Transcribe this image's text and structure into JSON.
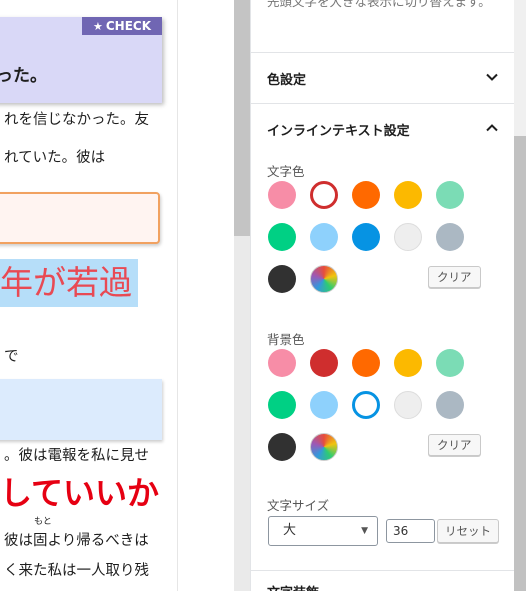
{
  "editor": {
    "check_label": "CHECK",
    "check_text": "った。",
    "paragraphs": [
      "れを信じなかった。友",
      "れていた。彼は",
      "で",
      "。彼は電報を私に見せ",
      "彼は固より帰るべきは",
      "く来た私は一人取り残"
    ],
    "highlight_text": "年が若過",
    "bold_red_text": "していいか",
    "ruby_text": "もと"
  },
  "sidebar": {
    "help_text": "先頭文字を大きな表示に切り替えます。",
    "color_panel": {
      "title": "色設定"
    },
    "inline_panel": {
      "title": "インラインテキスト設定",
      "text_color_label": "文字色",
      "text_colors": [
        "#f78da7",
        "#cf2e2e",
        "#ff6900",
        "#fcb900",
        "#7bdcb5",
        "#00d084",
        "#8ed1fc",
        "#0693e3",
        "#eeeeee",
        "#abb8c3",
        "#313131",
        "gradient"
      ],
      "text_color_selected": "#cf2e2e",
      "bg_color_label": "背景色",
      "bg_colors": [
        "#f78da7",
        "#cf2e2e",
        "#ff6900",
        "#fcb900",
        "#7bdcb5",
        "#00d084",
        "#8ed1fc",
        "#0693e3",
        "#eeeeee",
        "#abb8c3",
        "#313131",
        "gradient"
      ],
      "bg_color_selected": "#0693e3",
      "clear_label": "クリア",
      "font_size_label": "文字サイズ",
      "font_size_value": "大",
      "font_size_number": "36",
      "reset_label": "リセット"
    },
    "next_panel_title": "文字装飾"
  },
  "colors": {
    "check_bg": "#d9d8f7",
    "check_label_bg": "#7066b3",
    "red_text": "#e60012",
    "highlight_bg": "#b6def9"
  }
}
